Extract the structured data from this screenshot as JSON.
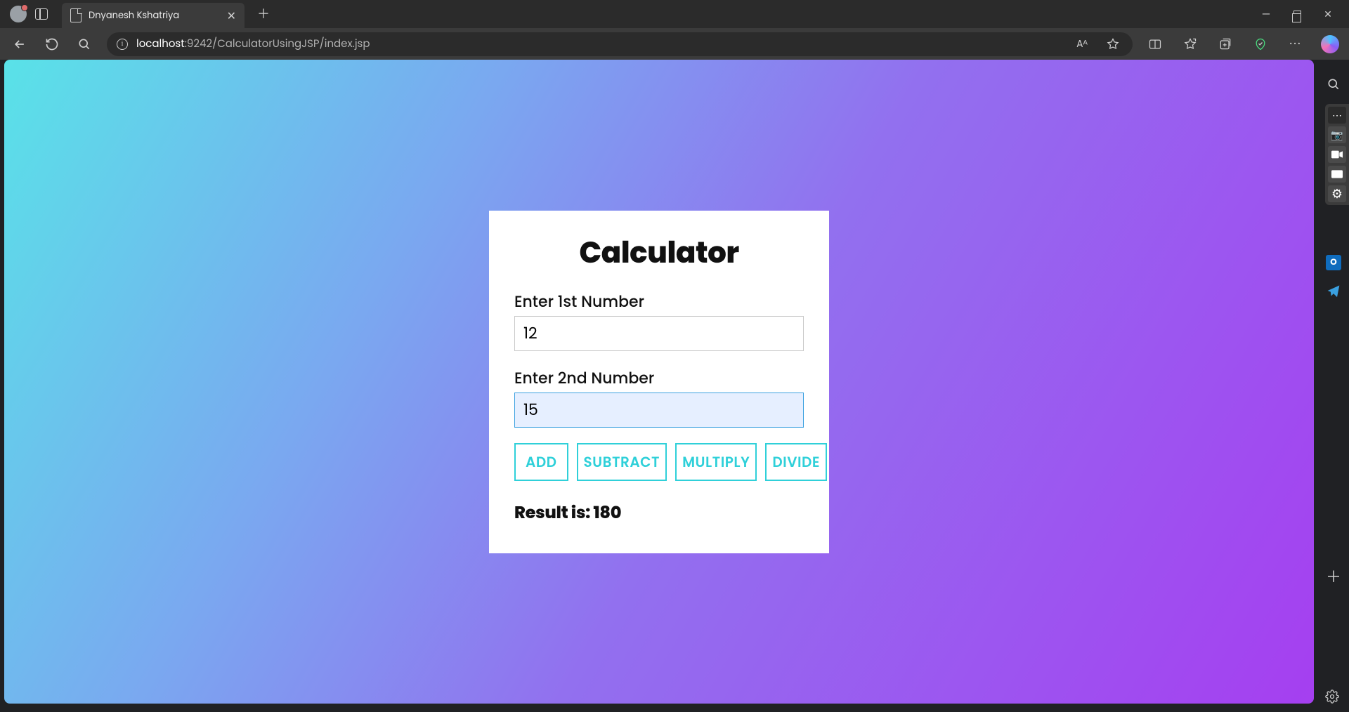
{
  "window": {
    "tab_title": "Dnyanesh Kshatriya",
    "url_prefix": "localhost",
    "url_rest": ":9242/CalculatorUsingJSP/index.jsp"
  },
  "icons": {
    "read_aloud": "A⁺",
    "aa": "Aᴬ"
  },
  "calculator": {
    "title": "Calculator",
    "label1": "Enter 1st Number",
    "value1": "12",
    "label2": "Enter 2nd Number",
    "value2": "15",
    "buttons": {
      "add": "ADD",
      "subtract": "SUBTRACT",
      "multiply": "MULTIPLY",
      "divide": "DIVIDE"
    },
    "result_label": "Result is: ",
    "result_value": "180"
  },
  "sidebar": {
    "outlook_label": "O",
    "camera": "📷",
    "video": "■",
    "screen": "▭",
    "gear": "⚙"
  }
}
